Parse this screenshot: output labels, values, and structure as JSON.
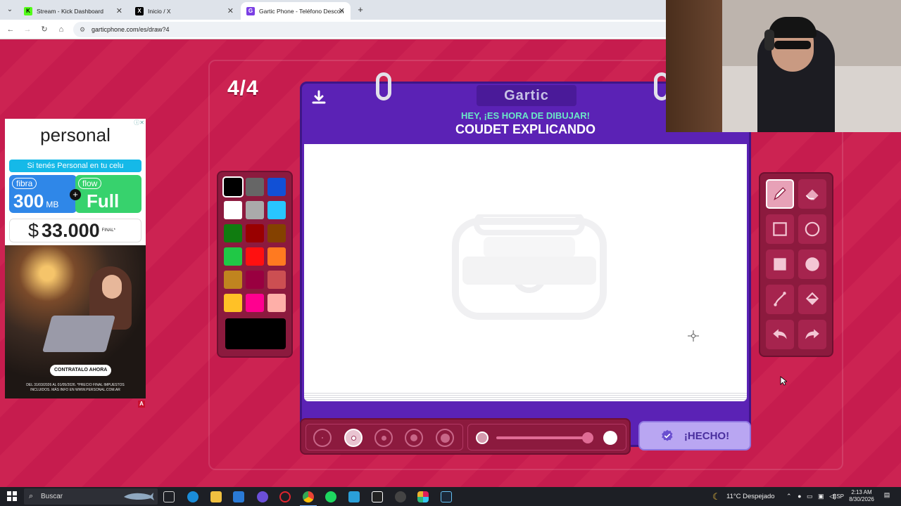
{
  "browser": {
    "tabs": [
      {
        "title": "Stream - Kick Dashboard",
        "icon": "kick-icon",
        "color": "#53fc18"
      },
      {
        "title": "Inicio / X",
        "icon": "x-icon",
        "color": "#000000"
      },
      {
        "title": "Gartic Phone - Teléfono Descon",
        "icon": "gartic-icon",
        "color": "#7b3fe4"
      }
    ],
    "url": "garticphone.com/es/draw?4"
  },
  "game": {
    "round": "4/4",
    "logo": "Gartic",
    "header_line": "HEY, ¡ES HORA DE DIBUJAR!",
    "prompt": "COUDET EXPLICANDO",
    "done_label": "¡HECHO!",
    "palette": [
      "#000000",
      "#666666",
      "#1150d6",
      "#ffffff",
      "#aaaaaa",
      "#28c6ff",
      "#107c10",
      "#990000",
      "#844100",
      "#20c846",
      "#ff1010",
      "#ff7a20",
      "#c0841f",
      "#990040",
      "#cc4f52",
      "#ffc126",
      "#ff008f",
      "#feafa8"
    ],
    "selected_color": "#000000",
    "tools": [
      "pencil-icon",
      "eraser-icon",
      "rectangle-outline-icon",
      "ellipse-outline-icon",
      "rectangle-filled-icon",
      "ellipse-filled-icon",
      "line-icon",
      "fill-bucket-icon",
      "undo-icon",
      "redo-icon"
    ],
    "active_tool": "pencil-icon",
    "brush_sizes": 5,
    "active_brush_size": 2,
    "opacity_level": 1.0,
    "colors": {
      "background": "#c8204e",
      "frame": "#5b22b5",
      "hey_text": "#6be7c7",
      "done_button": "#b9a6f2"
    }
  },
  "ad": {
    "brand": "personal",
    "strip": "Si tenés Personal en tu celu",
    "fibra_label": "fibra",
    "fibra_speed": "300",
    "fibra_unit": "MB",
    "flow_label": "flow",
    "flow_plan": "Full",
    "price_currency": "$",
    "price": "33.000",
    "price_note": "FINAL*",
    "cta": "CONTRATALO AHORA",
    "legal": "DEL 31/03/2026 AL 01/05/2026. *PRECIO FINAL IMPUESTOS INCLUIDOS. MÁS INFO EN WWW.PERSONAL.COM.AR"
  },
  "taskbar": {
    "search_placeholder": "Buscar",
    "weather": "11°C Despejado",
    "language": "ESP",
    "time": "2:13 AM",
    "date": "8/30/2026"
  }
}
